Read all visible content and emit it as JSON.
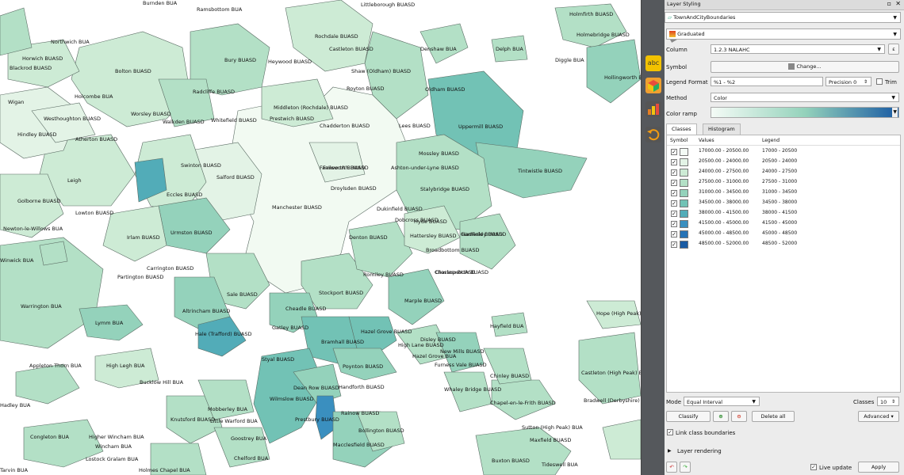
{
  "panel": {
    "title": "Layer Styling",
    "layer_name": "TownAndCityBoundaries",
    "renderer": "Graduated",
    "column_label": "Column",
    "column_value": "1.2.3  NALAHC",
    "symbol_label": "Symbol",
    "change_button": "Change...",
    "legend_format_label": "Legend Format",
    "legend_format_value": "%1 - %2",
    "precision_label": "Precision 0",
    "trim_label": "Trim",
    "method_label": "Method",
    "method_value": "Color",
    "color_ramp_label": "Color ramp",
    "tabs": [
      "Classes",
      "Histogram"
    ],
    "col_symbol": "Symbol",
    "col_values": "Values",
    "col_legend": "Legend",
    "classes": [
      {
        "values": "17000.00 - 20500.00",
        "legend": "17000 - 20500",
        "color": "#f4fbf6"
      },
      {
        "values": "20500.00 - 24000.00",
        "legend": "20500 - 24000",
        "color": "#e3f3e6"
      },
      {
        "values": "24000.00 - 27500.00",
        "legend": "24000 - 27500",
        "color": "#cdebd5"
      },
      {
        "values": "27500.00 - 31000.00",
        "legend": "27500 - 31000",
        "color": "#b3e0c6"
      },
      {
        "values": "31000.00 - 34500.00",
        "legend": "31000 - 34500",
        "color": "#94d2bb"
      },
      {
        "values": "34500.00 - 38000.00",
        "legend": "34500 - 38000",
        "color": "#72c2b5"
      },
      {
        "values": "38000.00 - 41500.00",
        "legend": "38000 - 41500",
        "color": "#52acb8"
      },
      {
        "values": "41500.00 - 45000.00",
        "legend": "41500 - 45000",
        "color": "#3a8fbf"
      },
      {
        "values": "45000.00 - 48500.00",
        "legend": "45000 - 48500",
        "color": "#2773b6"
      },
      {
        "values": "48500.00 - 52000.00",
        "legend": "48500 - 52000",
        "color": "#1a5ba3"
      }
    ],
    "mode_label": "Mode",
    "mode_value": "Equal Interval",
    "classes_label": "Classes",
    "classes_count": "10",
    "classify_button": "Classify",
    "delete_all_button": "Delete all",
    "advanced_button": "Advanced",
    "link_boundaries_label": "Link class boundaries",
    "layer_rendering_label": "Layer rendering",
    "live_update_label": "Live update",
    "apply_button": "Apply"
  },
  "map_labels": [
    "Burnden BUA",
    "Littleborough BUASD",
    "Holmfirth BUASD",
    "Ramsbottom BUA",
    "Rochdale BUASD",
    "Castleton BUASD",
    "Delph BUA",
    "Holmebridge BUASD",
    "Horwich BUASD",
    "Blackrod BUASD",
    "Westhoughton BUASD",
    "Hindley BUASD",
    "Atherton BUASD",
    "Walkden BUASD",
    "Bolton BUASD",
    "Bury BUASD",
    "Heywood BUASD",
    "Royton BUASD",
    "Uppermill BUASD",
    "Shaw (Oldham) BUASD",
    "Middleton (Rochdale) BUASD",
    "Farnworth BUASD",
    "Radcliffe BUASD",
    "Whitefield BUASD",
    "Prestwich BUASD",
    "Chadderton BUASD",
    "Oldham BUASD",
    "Lees BUASD",
    "Mossley BUASD",
    "Tintwistle BUASD",
    "Hadfield BUASD",
    "Swinton BUASD",
    "Salford BUASD",
    "Eccles BUASD",
    "Urmston BUASD",
    "Manchester BUASD",
    "Failsworth BUASD",
    "Droylsden BUASD",
    "Ashton-under-Lyne BUASD",
    "Stalybridge BUASD",
    "Dukinfield BUASD",
    "Hyde BUASD",
    "Denton BUASD",
    "Hattersley BUASD",
    "Gamesley BUASD",
    "Glossop BUASD",
    "Irlam BUASD",
    "Carrington BUASD",
    "Partington BUASD",
    "Sale BUASD",
    "Altrincham BUASD",
    "Hale (Trafford) BUASD",
    "Stockport BUASD",
    "Romiley BUASD",
    "Marple BUASD",
    "Cheadle BUASD",
    "Gatley BUASD",
    "Bramhall BUASD",
    "Hazel Grove BUASD",
    "High Lane BUASD",
    "Disley BUASD",
    "New Mills BUASD",
    "Poynton BUASD",
    "Furness Vale BUASD",
    "Whaley Bridge BUASD",
    "Chinley BUASD",
    "Chapel-en-le-Frith BUASD",
    "Buxton BUASD",
    "Wilmslow BUASD",
    "Dean Row BUASD",
    "Styal BUASD",
    "Handforth BUASD",
    "Prestbury BUASD",
    "Bollington BUASD",
    "Macclesfield BUASD",
    "Knutsford BUASD",
    "Lymm BUA",
    "Warrington BUA",
    "Appleton Thorn BUA",
    "High Legh BUA",
    "Bucklow Hill BUA",
    "Mobberley BUA",
    "Little Warford BUA",
    "Chelford BUA",
    "Holmes Chapel BUA",
    "Goostrey BUA",
    "Lostock Gralam BUA",
    "Congleton BUA",
    "Tideswell BUA",
    "Castleton (High Peak) BUA",
    "Bradwell (Derbyshire) BUA",
    "Hope (High Peak) BUA",
    "Hayfield BUA",
    "Leigh",
    "Wigan",
    "Golborne BUASD",
    "Lowton BUASD",
    "Newton-le-Willows BUA",
    "Winwick BUA",
    "Worsley BUASD",
    "Rainow BUASD",
    "Sutton (High Peak) BUA",
    "Hadley BUA",
    "Northwich BUA",
    "Higher Wincham BUA",
    "Maxfield BUASD",
    "Wincham BUA",
    "Broadbottom BUASD",
    "Charlesworth BUASD",
    "Tarvin BUA",
    "Holcombe BUA",
    "Denshaw BUA",
    "Diggle BUA",
    "Dobcross BUASD",
    "Hollingworth BUA",
    "Hazel Grove BUA"
  ]
}
